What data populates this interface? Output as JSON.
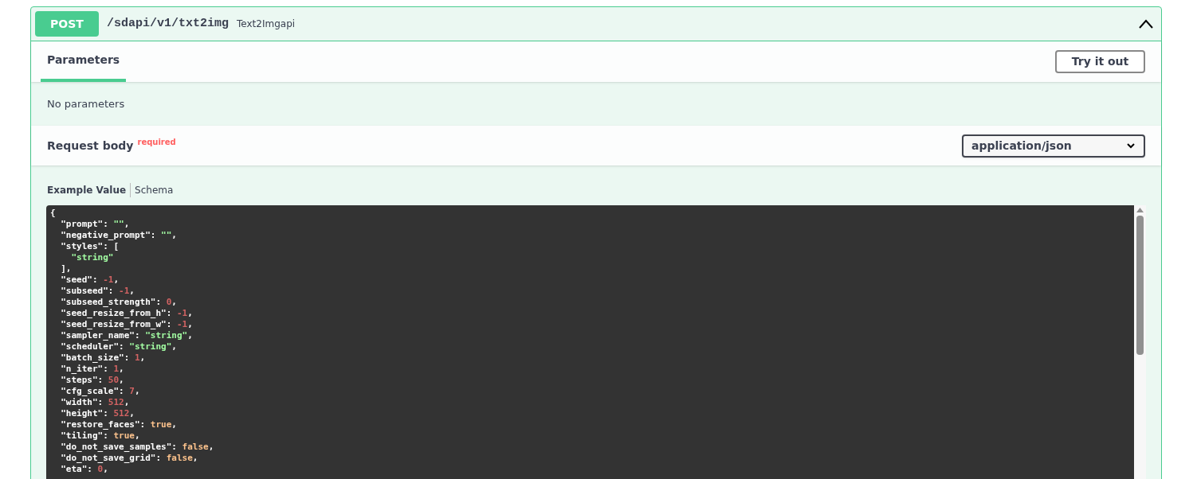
{
  "operation": {
    "method": "POST",
    "path": "/sdapi/v1/txt2img",
    "summary": "Text2Imgapi",
    "expanded": true
  },
  "tabs": [
    {
      "label": "Parameters",
      "selected": true
    }
  ],
  "try_button": "Try it out",
  "parameters_message": "No parameters",
  "request_body": {
    "title": "Request body",
    "required_label": "required",
    "content_type": "application/json"
  },
  "example_tabs": [
    {
      "label": "Example Value",
      "selected": true
    },
    {
      "label": "Schema",
      "selected": false
    }
  ],
  "code_lines": [
    [
      {
        "kind": "punct",
        "text": "{"
      }
    ],
    [
      {
        "kind": "key",
        "text": "  \"prompt\": "
      },
      {
        "kind": "string",
        "text": "\"\""
      },
      {
        "kind": "punct",
        "text": ","
      }
    ],
    [
      {
        "kind": "key",
        "text": "  \"negative_prompt\": "
      },
      {
        "kind": "string",
        "text": "\"\""
      },
      {
        "kind": "punct",
        "text": ","
      }
    ],
    [
      {
        "kind": "key",
        "text": "  \"styles\": ["
      }
    ],
    [
      {
        "kind": "string",
        "text": "    \"string\""
      }
    ],
    [
      {
        "kind": "punct",
        "text": "  ],"
      }
    ],
    [
      {
        "kind": "key",
        "text": "  \"seed\": "
      },
      {
        "kind": "number",
        "text": "-1"
      },
      {
        "kind": "punct",
        "text": ","
      }
    ],
    [
      {
        "kind": "key",
        "text": "  \"subseed\": "
      },
      {
        "kind": "number",
        "text": "-1"
      },
      {
        "kind": "punct",
        "text": ","
      }
    ],
    [
      {
        "kind": "key",
        "text": "  \"subseed_strength\": "
      },
      {
        "kind": "number",
        "text": "0"
      },
      {
        "kind": "punct",
        "text": ","
      }
    ],
    [
      {
        "kind": "key",
        "text": "  \"seed_resize_from_h\": "
      },
      {
        "kind": "number",
        "text": "-1"
      },
      {
        "kind": "punct",
        "text": ","
      }
    ],
    [
      {
        "kind": "key",
        "text": "  \"seed_resize_from_w\": "
      },
      {
        "kind": "number",
        "text": "-1"
      },
      {
        "kind": "punct",
        "text": ","
      }
    ],
    [
      {
        "kind": "key",
        "text": "  \"sampler_name\": "
      },
      {
        "kind": "string",
        "text": "\"string\""
      },
      {
        "kind": "punct",
        "text": ","
      }
    ],
    [
      {
        "kind": "key",
        "text": "  \"scheduler\": "
      },
      {
        "kind": "string",
        "text": "\"string\""
      },
      {
        "kind": "punct",
        "text": ","
      }
    ],
    [
      {
        "kind": "key",
        "text": "  \"batch_size\": "
      },
      {
        "kind": "number",
        "text": "1"
      },
      {
        "kind": "punct",
        "text": ","
      }
    ],
    [
      {
        "kind": "key",
        "text": "  \"n_iter\": "
      },
      {
        "kind": "number",
        "text": "1"
      },
      {
        "kind": "punct",
        "text": ","
      }
    ],
    [
      {
        "kind": "key",
        "text": "  \"steps\": "
      },
      {
        "kind": "number",
        "text": "50"
      },
      {
        "kind": "punct",
        "text": ","
      }
    ],
    [
      {
        "kind": "key",
        "text": "  \"cfg_scale\": "
      },
      {
        "kind": "number",
        "text": "7"
      },
      {
        "kind": "punct",
        "text": ","
      }
    ],
    [
      {
        "kind": "key",
        "text": "  \"width\": "
      },
      {
        "kind": "number",
        "text": "512"
      },
      {
        "kind": "punct",
        "text": ","
      }
    ],
    [
      {
        "kind": "key",
        "text": "  \"height\": "
      },
      {
        "kind": "number",
        "text": "512"
      },
      {
        "kind": "punct",
        "text": ","
      }
    ],
    [
      {
        "kind": "key",
        "text": "  \"restore_faces\": "
      },
      {
        "kind": "boolean",
        "text": "true"
      },
      {
        "kind": "punct",
        "text": ","
      }
    ],
    [
      {
        "kind": "key",
        "text": "  \"tiling\": "
      },
      {
        "kind": "boolean",
        "text": "true"
      },
      {
        "kind": "punct",
        "text": ","
      }
    ],
    [
      {
        "kind": "key",
        "text": "  \"do_not_save_samples\": "
      },
      {
        "kind": "boolean",
        "text": "false"
      },
      {
        "kind": "punct",
        "text": ","
      }
    ],
    [
      {
        "kind": "key",
        "text": "  \"do_not_save_grid\": "
      },
      {
        "kind": "boolean",
        "text": "false"
      },
      {
        "kind": "punct",
        "text": ","
      }
    ],
    [
      {
        "kind": "key",
        "text": "  \"eta\": "
      },
      {
        "kind": "number",
        "text": "0"
      },
      {
        "kind": "punct",
        "text": ","
      }
    ]
  ]
}
